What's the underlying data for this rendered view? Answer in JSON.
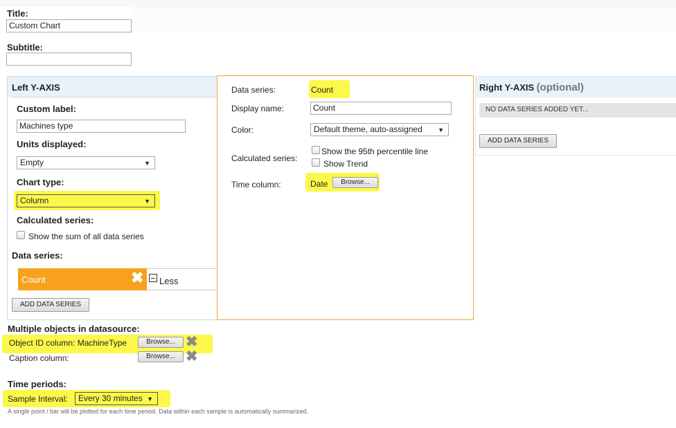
{
  "general": {
    "title_label": "Title:",
    "title_value": "Custom Chart",
    "subtitle_label": "Subtitle:",
    "subtitle_value": ""
  },
  "left_axis": {
    "heading": "Left Y-AXIS",
    "custom_label_label": "Custom label:",
    "custom_label_value": "Machines type",
    "units_label": "Units displayed:",
    "units_value": "Empty",
    "chart_type_label": "Chart type:",
    "chart_type_value": "Column",
    "calc_series_label": "Calculated series:",
    "sum_checkbox_label": "Show the sum of all data series",
    "data_series_label": "Data series:",
    "series": [
      {
        "name": "Count",
        "color": "#f7a11e"
      }
    ],
    "less_label": "Less",
    "add_button": "ADD DATA SERIES"
  },
  "series_detail": {
    "data_series_label": "Data series:",
    "data_series_value": "Count",
    "display_name_label": "Display name:",
    "display_name_value": "Count",
    "color_label": "Color:",
    "color_value": "Default theme, auto-assigned",
    "calculated_label": "Calculated series:",
    "percentile_label": "Show the 95th percentile line",
    "trend_label": "Show Trend",
    "time_column_label": "Time column:",
    "time_column_value": "Date",
    "browse_button": "Browse..."
  },
  "right_axis": {
    "heading": "Right Y-AXIS",
    "heading_optional": "(optional)",
    "empty_message": "NO DATA SERIES ADDED YET...",
    "add_button": "ADD DATA SERIES"
  },
  "multi_objects": {
    "heading": "Multiple objects in datasource:",
    "object_id_label": "Object ID column:",
    "object_id_value": "MachineType",
    "caption_label": "Caption column:",
    "browse_button": "Browse..."
  },
  "time_periods": {
    "heading": "Time periods:",
    "sample_label": "Sample Interval:",
    "sample_value": "Every 30 minutes",
    "note": "A single point / bar will be plotted for each time period. Data within each sample is automatically summarized."
  },
  "colors": {
    "highlight": "#fbf84a",
    "series_orange": "#f7a11e",
    "panel_border_orange": "#f0a830",
    "panel_header_blue": "#e9f1f9"
  },
  "icons": {
    "remove": "x-icon",
    "collapse": "minus-box-icon",
    "dropdown": "triangle-down-icon"
  }
}
